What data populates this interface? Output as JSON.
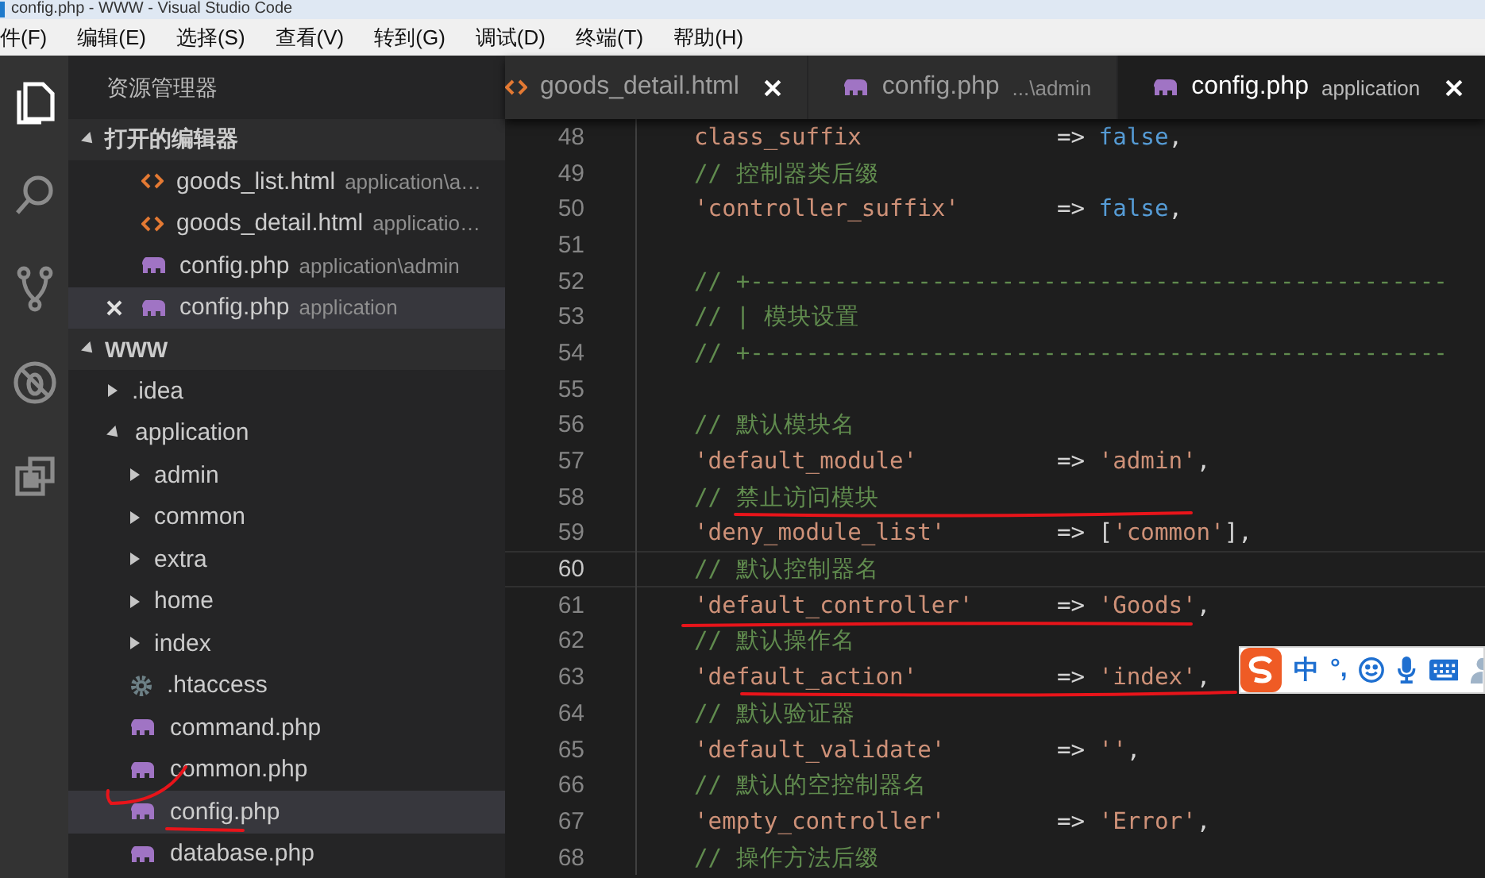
{
  "window": {
    "title": "config.php - WWW - Visual Studio Code"
  },
  "menu": [
    "件(F)",
    "编辑(E)",
    "选择(S)",
    "查看(V)",
    "转到(G)",
    "调试(D)",
    "终端(T)",
    "帮助(H)"
  ],
  "activity_bar": [
    {
      "kind": "files",
      "selected": true
    },
    {
      "kind": "search",
      "selected": false
    },
    {
      "kind": "source-control",
      "selected": false
    },
    {
      "kind": "debug",
      "selected": false
    },
    {
      "kind": "extensions",
      "selected": false
    }
  ],
  "explorer": {
    "title": "资源管理器",
    "open_editors": {
      "title": "打开的编辑器",
      "expanded": true,
      "items": [
        {
          "kind": "html",
          "name": "goods_list.html",
          "path": "application\\a…",
          "selected": false
        },
        {
          "kind": "html",
          "name": "goods_detail.html",
          "path": "applicatio…",
          "selected": false
        },
        {
          "kind": "php",
          "name": "config.php",
          "path": "application\\admin",
          "selected": false
        },
        {
          "kind": "php",
          "name": "config.php",
          "path": "application",
          "selected": true
        }
      ]
    },
    "folder": {
      "name": "WWW",
      "expanded": true,
      "children": [
        {
          "kind": "folder",
          "name": ".idea",
          "expanded": false,
          "selected": false
        },
        {
          "kind": "folder",
          "name": "application",
          "expanded": true,
          "selected": false,
          "children": [
            {
              "kind": "folder",
              "name": "admin",
              "expanded": false,
              "selected": false
            },
            {
              "kind": "folder",
              "name": "common",
              "expanded": false,
              "selected": false
            },
            {
              "kind": "folder",
              "name": "extra",
              "expanded": false,
              "selected": false
            },
            {
              "kind": "folder",
              "name": "home",
              "expanded": false,
              "selected": false
            },
            {
              "kind": "folder",
              "name": "index",
              "expanded": false,
              "selected": false
            },
            {
              "kind": "settings",
              "name": ".htaccess",
              "selected": false
            },
            {
              "kind": "php",
              "name": "command.php",
              "selected": false
            },
            {
              "kind": "php",
              "name": "common.php",
              "selected": false
            },
            {
              "kind": "php",
              "name": "config.php",
              "selected": true
            },
            {
              "kind": "php",
              "name": "database.php",
              "selected": false
            }
          ]
        }
      ]
    }
  },
  "tabs": [
    {
      "kind": "html",
      "name": "goods_detail.html",
      "close_button": true,
      "selected": false
    },
    {
      "kind": "php",
      "name": "config.php",
      "path": "...\\admin",
      "close_button": false,
      "selected": false
    },
    {
      "kind": "php",
      "name": "config.php",
      "path": "application",
      "close_button": true,
      "selected": true
    }
  ],
  "code_lines": [
    {
      "number": "48",
      "current": false,
      "tokens": [
        {
          "kind": "key",
          "text": "class_suffix"
        },
        {
          "kind": "op",
          "text": "=>"
        },
        {
          "kind": "keyword",
          "text": "false"
        },
        {
          "kind": "punct",
          "text": ","
        }
      ]
    },
    {
      "number": "49",
      "current": false,
      "tokens": [
        {
          "kind": "comment",
          "text": "// 控制器类后缀"
        }
      ]
    },
    {
      "number": "50",
      "current": false,
      "tokens": [
        {
          "kind": "key",
          "text": "'controller_suffix'"
        },
        {
          "kind": "op",
          "text": "=>"
        },
        {
          "kind": "keyword",
          "text": "false"
        },
        {
          "kind": "punct",
          "text": ","
        }
      ]
    },
    {
      "number": "51",
      "current": false
    },
    {
      "number": "52",
      "current": false,
      "tokens": [
        {
          "kind": "comment",
          "text": "// +--------------------------------------------------"
        }
      ]
    },
    {
      "number": "53",
      "current": false,
      "tokens": [
        {
          "kind": "comment",
          "text": "// | 模块设置"
        }
      ]
    },
    {
      "number": "54",
      "current": false,
      "tokens": [
        {
          "kind": "comment",
          "text": "// +--------------------------------------------------"
        }
      ]
    },
    {
      "number": "55",
      "current": false
    },
    {
      "number": "56",
      "current": false,
      "tokens": [
        {
          "kind": "comment",
          "text": "// 默认模块名"
        }
      ]
    },
    {
      "number": "57",
      "current": false,
      "tokens": [
        {
          "kind": "key",
          "text": "'default_module'"
        },
        {
          "kind": "op",
          "text": "=>"
        },
        {
          "kind": "string",
          "text": "'admin'"
        },
        {
          "kind": "punct",
          "text": ","
        }
      ]
    },
    {
      "number": "58",
      "current": false,
      "tokens": [
        {
          "kind": "comment",
          "text": "// 禁止访问模块"
        }
      ]
    },
    {
      "number": "59",
      "current": false,
      "tokens": [
        {
          "kind": "key",
          "text": "'deny_module_list'"
        },
        {
          "kind": "op",
          "text": "=>"
        },
        {
          "kind": "punct",
          "text": "["
        },
        {
          "kind": "string",
          "text": "'common'"
        },
        {
          "kind": "punct",
          "text": "],"
        }
      ]
    },
    {
      "number": "60",
      "current": true,
      "tokens": [
        {
          "kind": "comment",
          "text": "// 默认控制器名"
        }
      ]
    },
    {
      "number": "61",
      "current": false,
      "tokens": [
        {
          "kind": "key",
          "text": "'default_controller'"
        },
        {
          "kind": "op",
          "text": "=>"
        },
        {
          "kind": "string",
          "text": "'Goods'"
        },
        {
          "kind": "punct",
          "text": ","
        }
      ]
    },
    {
      "number": "62",
      "current": false,
      "tokens": [
        {
          "kind": "comment",
          "text": "// 默认操作名"
        }
      ]
    },
    {
      "number": "63",
      "current": false,
      "tokens": [
        {
          "kind": "key",
          "text": "'default_action'"
        },
        {
          "kind": "op",
          "text": "=>"
        },
        {
          "kind": "string",
          "text": "'index'"
        },
        {
          "kind": "punct",
          "text": ","
        }
      ]
    },
    {
      "number": "64",
      "current": false,
      "tokens": [
        {
          "kind": "comment",
          "text": "// 默认验证器"
        }
      ]
    },
    {
      "number": "65",
      "current": false,
      "tokens": [
        {
          "kind": "key",
          "text": "'default_validate'"
        },
        {
          "kind": "op",
          "text": "=>"
        },
        {
          "kind": "string",
          "text": "''"
        },
        {
          "kind": "punct",
          "text": ","
        }
      ]
    },
    {
      "number": "66",
      "current": false,
      "tokens": [
        {
          "kind": "comment",
          "text": "// 默认的空控制器名"
        }
      ]
    },
    {
      "number": "67",
      "current": false,
      "tokens": [
        {
          "kind": "key",
          "text": "'empty_controller'"
        },
        {
          "kind": "op",
          "text": "=>"
        },
        {
          "kind": "string",
          "text": "'Error'"
        },
        {
          "kind": "punct",
          "text": ","
        }
      ]
    },
    {
      "number": "68",
      "current": false,
      "tokens": [
        {
          "kind": "comment",
          "text": "// 操作方法后缀"
        }
      ]
    }
  ],
  "ime_toolbar": {
    "mode": "中",
    "punctuation": "°,"
  }
}
